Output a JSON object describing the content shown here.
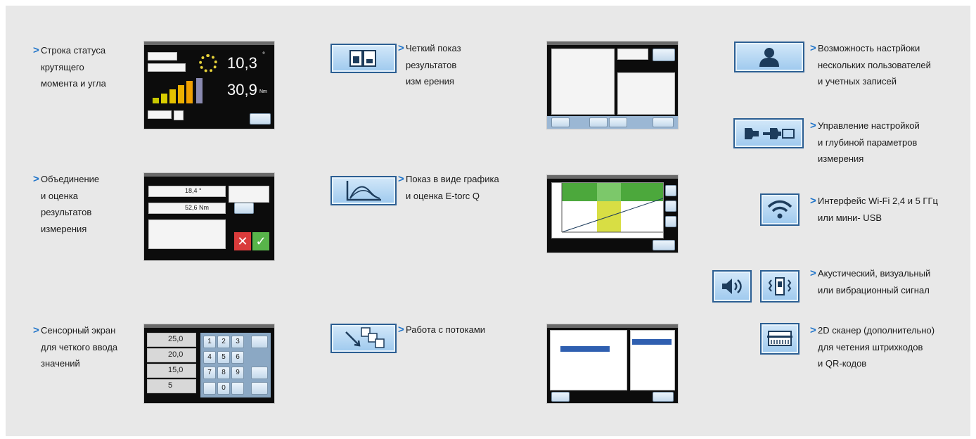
{
  "colors": {
    "accent": "#1e73c9",
    "panel_bg": "#e8e8e8",
    "icon_border": "#2c5f93",
    "icon_fill": "#b6d8f4"
  },
  "features": {
    "torque_status": {
      "lines": [
        "Строка статуса",
        "крутящего",
        "момента и угла"
      ]
    },
    "combine_results": {
      "lines": [
        "Объединение",
        "и оценка",
        "результатов",
        "измерения"
      ]
    },
    "touch_screen": {
      "lines": [
        "Сенсорный экран",
        "для четкого ввода",
        "значений"
      ]
    },
    "clear_results": {
      "lines": [
        "Четкий показ",
        "результатов",
        "изм ерения"
      ]
    },
    "graph_view": {
      "lines": [
        "Показ в виде графика",
        "и оценка E-torc Q"
      ]
    },
    "streams": {
      "lines": [
        "Работа с потоками"
      ]
    },
    "multi_user": {
      "lines": [
        "Возможность настрйоки",
        "нескольких пользователей",
        "и учетных записей"
      ]
    },
    "settings_depth": {
      "lines": [
        "Управление настройкой",
        "и глубиной параметров",
        "измерения"
      ]
    },
    "wifi": {
      "lines": [
        "Интерфейс Wi-Fi 2,4 и 5 ГГц",
        "или мини- USB"
      ]
    },
    "signals": {
      "lines": [
        "Акустический, визуальный",
        "или вибрационный сигнал"
      ]
    },
    "scanner": {
      "lines": [
        "2D сканер (дополнительно)",
        "для четения штрихкодов",
        "и  QR-кодов"
      ]
    }
  },
  "screens": {
    "torque": {
      "torque_value": "10,3",
      "angle_value": "30,9",
      "angle_unit": "°",
      "torque_unit": "Nm"
    },
    "combine": {
      "angle_value": "18,4 °",
      "torque_value": "52,6 Nm"
    },
    "keypad": {
      "values": [
        "25,0",
        "20,0",
        "15,0",
        "5"
      ],
      "keys": [
        "1",
        "2",
        "3",
        "4",
        "5",
        "6",
        "7",
        "8",
        "9",
        "0"
      ]
    }
  },
  "icons": [
    "results-compare-icon",
    "graph-icon",
    "streams-icon",
    "user-icon",
    "wrench-settings-icon",
    "wifi-icon",
    "speaker-icon",
    "vibration-icon",
    "barcode-scanner-icon"
  ]
}
